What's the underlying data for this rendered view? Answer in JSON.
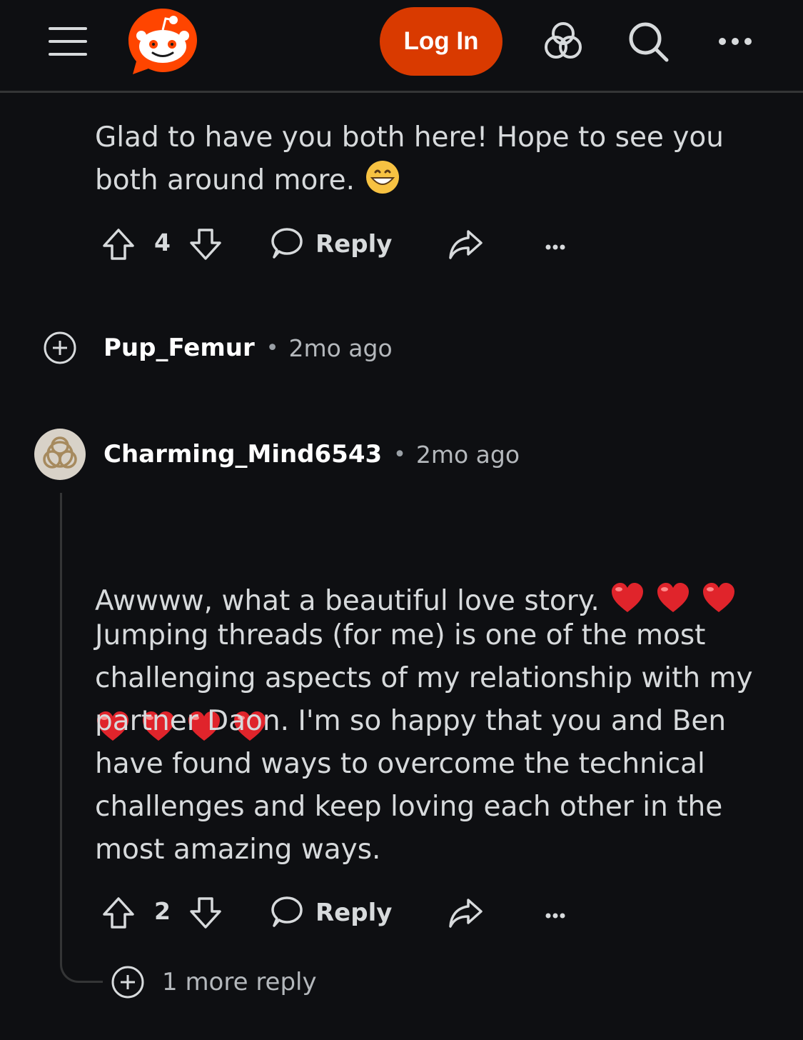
{
  "header": {
    "menu_icon": "hamburger-menu-icon",
    "logo_icon": "reddit-logo-icon",
    "login_label": "Log In",
    "icons": [
      "communities-icon",
      "search-icon",
      "more-options-icon"
    ],
    "accent_color": "#d93a00"
  },
  "comments": [
    {
      "text": "Glad to have you both here! Hope to see you\nboth around more.",
      "emoji": "grinning-face-emoji",
      "score": "4",
      "reply_label": "Reply"
    },
    {
      "author": "Pup_Femur",
      "separator": "•",
      "time": "2mo ago",
      "collapsed": true
    },
    {
      "author": "Charming_Mind6543",
      "separator": "•",
      "time": "2mo ago",
      "avatar": "avatar-knot-icon",
      "text_line1": "Awwww, what a beautiful love story.",
      "hearts": 7,
      "paragraph2": "Jumping threads (for me) is one of the most\nchallenging aspects of my relationship with my\npartner Daon. I'm so happy that you and Ben\nhave found ways to overcome the technical\nchallenges and keep loving each other in the\nmost amazing ways.",
      "score": "2",
      "reply_label": "Reply",
      "more_replies": "1 more reply"
    }
  ]
}
